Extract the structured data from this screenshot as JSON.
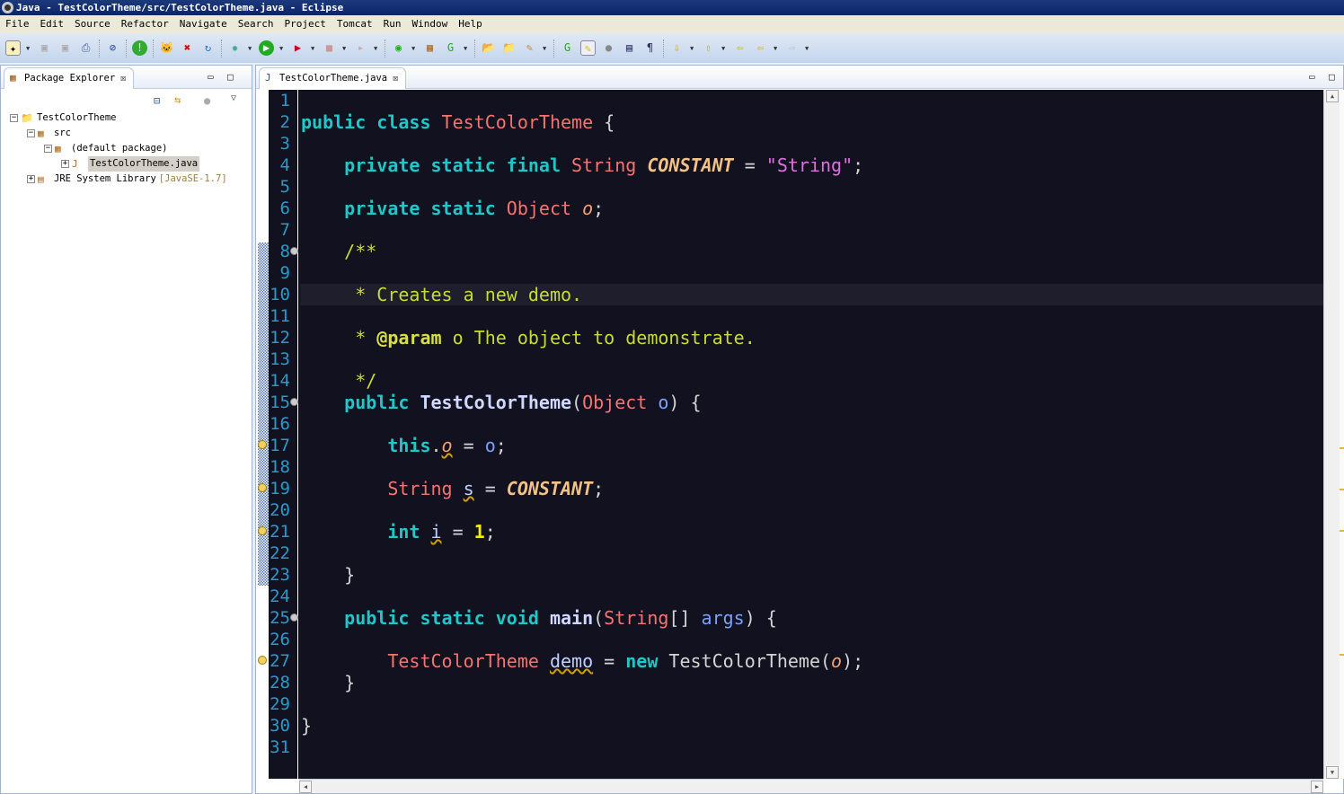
{
  "window": {
    "title": "Java - TestColorTheme/src/TestColorTheme.java - Eclipse"
  },
  "menu": [
    "File",
    "Edit",
    "Source",
    "Refactor",
    "Navigate",
    "Search",
    "Project",
    "Tomcat",
    "Run",
    "Window",
    "Help"
  ],
  "package_explorer": {
    "tab_label": "Package Explorer",
    "tree": [
      {
        "label": "TestColorTheme",
        "depth": 0,
        "expander": "−",
        "icon": "project-icon"
      },
      {
        "label": "src",
        "depth": 1,
        "expander": "−",
        "icon": "source-folder-icon"
      },
      {
        "label": "(default package)",
        "depth": 2,
        "expander": "−",
        "icon": "package-icon"
      },
      {
        "label": "TestColorTheme.java",
        "depth": 3,
        "expander": "+",
        "icon": "java-file-icon",
        "selected": true
      },
      {
        "label": "JRE System Library",
        "decoration": "[JavaSE-1.7]",
        "depth": 1,
        "expander": "+",
        "icon": "library-icon"
      }
    ]
  },
  "editor": {
    "tab_label": "TestColorTheme.java",
    "line_count": 31,
    "current_line": 10,
    "lines": {
      "2": [
        [
          "public class ",
          "kw"
        ],
        [
          "TestColorTheme",
          "ty"
        ],
        [
          " {",
          "pl"
        ]
      ],
      "4": [
        [
          "    private static final ",
          "kw"
        ],
        [
          "String ",
          "ty"
        ],
        [
          "CONSTANT",
          "cn"
        ],
        [
          " = ",
          "pl"
        ],
        [
          "\"String\"",
          "st"
        ],
        [
          ";",
          "pl"
        ]
      ],
      "6": [
        [
          "    private static ",
          "kw"
        ],
        [
          "Object ",
          "ty"
        ],
        [
          "o",
          "fi"
        ],
        [
          ";",
          "pl"
        ]
      ],
      "8": [
        [
          "    /**",
          "cm"
        ]
      ],
      "10": [
        [
          "     * Creates a new demo.",
          "cm"
        ]
      ],
      "12": [
        [
          "     * ",
          "cm"
        ],
        [
          "@param",
          "cmb"
        ],
        [
          " o The object to demonstrate.",
          "cm"
        ]
      ],
      "14": [
        [
          "     */",
          "cm"
        ]
      ],
      "15": [
        [
          "    public ",
          "kw"
        ],
        [
          "TestColorTheme",
          "me"
        ],
        [
          "(",
          "pl"
        ],
        [
          "Object ",
          "ty"
        ],
        [
          "o",
          "pa"
        ],
        [
          ") {",
          "pl"
        ]
      ],
      "17": [
        [
          "        this",
          "kw"
        ],
        [
          ".",
          "pl"
        ],
        [
          "o",
          "fd"
        ],
        [
          " = ",
          "pl"
        ],
        [
          "o",
          "pa"
        ],
        [
          ";",
          "pl"
        ]
      ],
      "19": [
        [
          "        String ",
          "ty"
        ],
        [
          "s",
          "lv"
        ],
        [
          " = ",
          "pl"
        ],
        [
          "CONSTANT",
          "cn"
        ],
        [
          ";",
          "pl"
        ]
      ],
      "21": [
        [
          "        int ",
          "kw"
        ],
        [
          "i",
          "lv"
        ],
        [
          " = ",
          "pl"
        ],
        [
          "1",
          "nu"
        ],
        [
          ";",
          "pl"
        ]
      ],
      "23": [
        [
          "    }",
          "pl"
        ]
      ],
      "25": [
        [
          "    public static void ",
          "kw"
        ],
        [
          "main",
          "me"
        ],
        [
          "(",
          "pl"
        ],
        [
          "String",
          "ty"
        ],
        [
          "[] ",
          "pl"
        ],
        [
          "args",
          "pa"
        ],
        [
          ") {",
          "pl"
        ]
      ],
      "27": [
        [
          "        TestColorTheme ",
          "ty"
        ],
        [
          "demo",
          "lv"
        ],
        [
          " = ",
          "pl"
        ],
        [
          "new ",
          "kw"
        ],
        [
          "TestColorTheme(",
          "pl"
        ],
        [
          "o",
          "fi"
        ],
        [
          ");",
          "pl"
        ]
      ],
      "28": [
        [
          "    }",
          "pl"
        ]
      ],
      "30": [
        [
          "}",
          "pl"
        ]
      ]
    },
    "fold_lines": [
      8,
      15,
      25
    ],
    "warning_lines": [
      17,
      19,
      21,
      27
    ]
  },
  "colors": {
    "editor_bg": "#12111f",
    "keyword": "#1cc8c8",
    "type": "#f57470",
    "comment": "#c8dc30",
    "string": "#e070e0",
    "line_number": "#2a9ac8"
  }
}
